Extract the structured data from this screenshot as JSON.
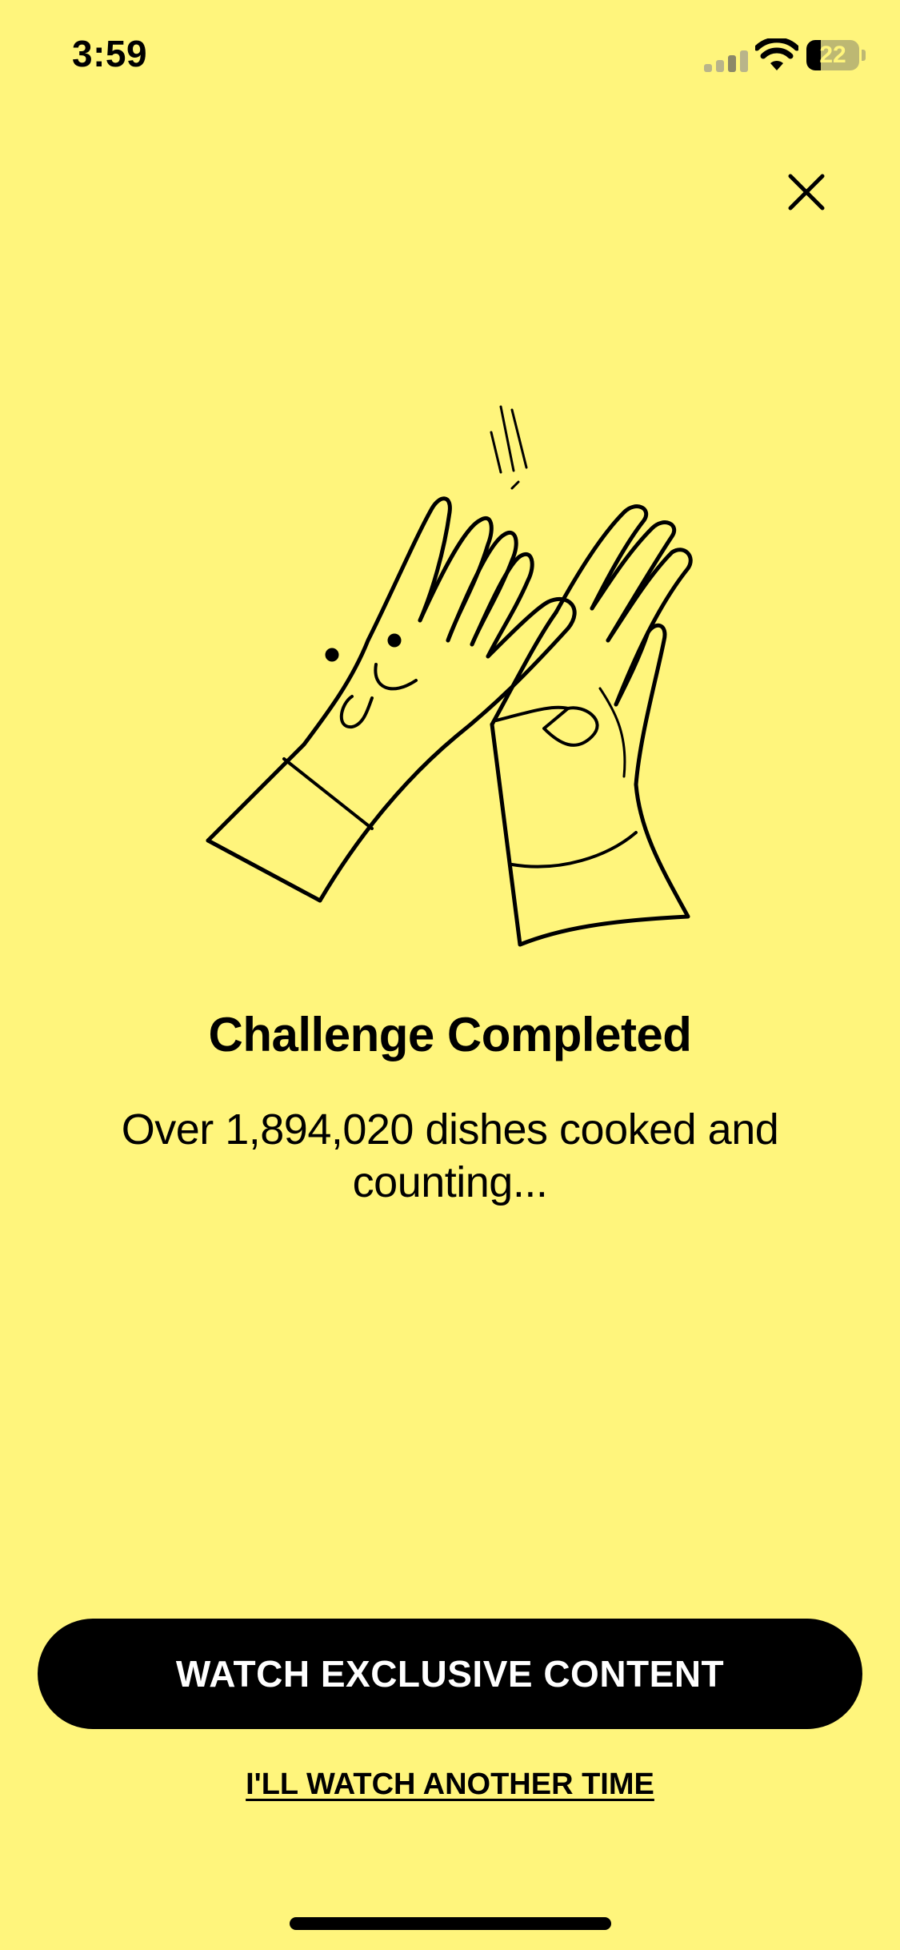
{
  "status_bar": {
    "time": "3:59",
    "battery_level": "22",
    "icons": [
      "signal-icon",
      "wifi-icon",
      "battery-icon"
    ]
  },
  "close": {
    "icon": "close-icon"
  },
  "illustration": {
    "icon": "high-five-hands-illustration"
  },
  "content": {
    "title": "Challenge Completed",
    "subtitle": "Over 1,894,020 dishes cooked and counting..."
  },
  "actions": {
    "primary_label": "WATCH EXCLUSIVE CONTENT",
    "secondary_label": "I'LL WATCH ANOTHER TIME"
  },
  "colors": {
    "background": "#FFF57C",
    "primary_button": "#000000",
    "primary_button_text": "#FFFFFF"
  }
}
